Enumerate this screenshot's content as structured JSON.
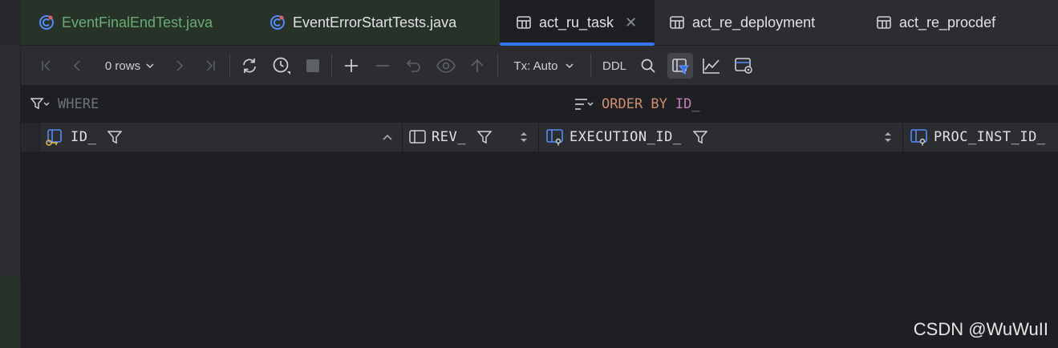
{
  "tabs": [
    {
      "label": "EventFinalEndTest.java",
      "icon": "java-class-icon",
      "state": "green"
    },
    {
      "label": "EventErrorStartTests.java",
      "icon": "java-class-icon",
      "state": "green"
    },
    {
      "label": "act_ru_task",
      "icon": "table-icon",
      "state": "active",
      "closable": true
    },
    {
      "label": "act_re_deployment",
      "icon": "table-icon",
      "state": "normal"
    },
    {
      "label": "act_re_procdef",
      "icon": "table-icon",
      "state": "normal"
    }
  ],
  "toolbar": {
    "rows_label": "0 rows",
    "tx_label": "Tx: Auto",
    "ddl_label": "DDL"
  },
  "filter": {
    "where_label": "WHERE",
    "order_by_keyword": "ORDER BY",
    "order_by_column": "ID_"
  },
  "columns": [
    {
      "name": "ID_",
      "icon": "primary-key-column-icon",
      "sort": "ascending"
    },
    {
      "name": "REV_",
      "icon": "column-icon",
      "sort": "unsorted"
    },
    {
      "name": "EXECUTION_ID_",
      "icon": "foreign-key-column-icon",
      "sort": "unsorted"
    },
    {
      "name": "PROC_INST_ID_",
      "icon": "foreign-key-column-icon",
      "sort": "unsorted"
    }
  ],
  "rows": [],
  "watermark": "CSDN @WuWuII",
  "colors": {
    "accent": "#3574f0",
    "green_text": "#6aab73",
    "keyword": "#cf8e6d",
    "column_ref": "#c77dbb"
  }
}
